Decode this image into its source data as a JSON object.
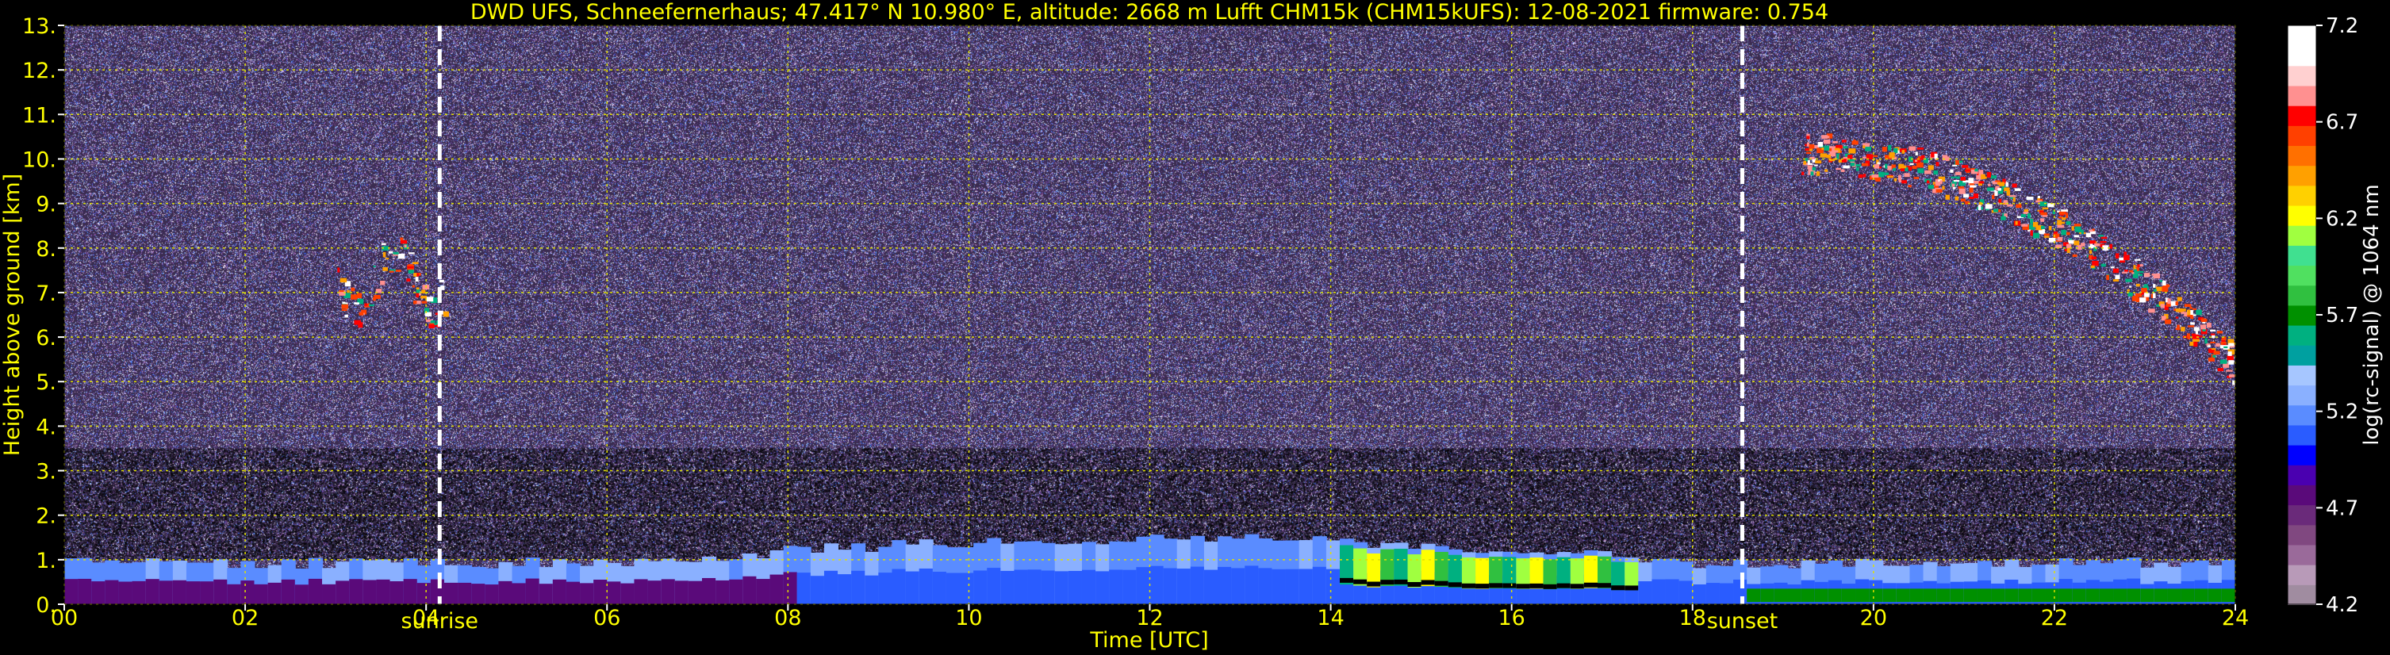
{
  "chart_data": {
    "type": "heatmap",
    "title": "DWD UFS, Schneefernerhaus; 47.417° N 10.980° E, altitude: 2668 m    Lufft CHM15k (CHM15kUFS): 12-08-2021    firmware: 0.754",
    "xlabel": "Time [UTC]",
    "ylabel": "Height above ground [km]",
    "xlim": [
      0,
      24
    ],
    "ylim": [
      0,
      13
    ],
    "x_ticks": [
      "00",
      "02",
      "04",
      "06",
      "08",
      "10",
      "12",
      "14",
      "16",
      "18",
      "20",
      "22",
      "24"
    ],
    "y_ticks": [
      "0.",
      "1.",
      "2.",
      "3.",
      "4.",
      "5.",
      "6.",
      "7.",
      "8.",
      "9.",
      "10.",
      "11.",
      "12.",
      "13."
    ],
    "grid": true,
    "markers": [
      {
        "label": "sunrise",
        "x": 4.15
      },
      {
        "label": "sunset",
        "x": 18.55
      }
    ],
    "colorbar": {
      "label": "log(rc-signal) @ 1064 nm",
      "range": [
        4.2,
        7.2
      ],
      "ticks": [
        "4.2",
        "4.7",
        "5.2",
        "5.7",
        "6.2",
        "6.7",
        "7.2"
      ],
      "colors": [
        "#a08ca0",
        "#b89ab8",
        "#9a6a9a",
        "#804880",
        "#6a2a7a",
        "#5a0a7a",
        "#4a00b0",
        "#0000ff",
        "#2a5cff",
        "#5a8cff",
        "#8ab0ff",
        "#a6c6ff",
        "#00a0a0",
        "#00b080",
        "#009000",
        "#30c040",
        "#50e060",
        "#40e090",
        "#a0ff40",
        "#ffff00",
        "#ffd000",
        "#ffa000",
        "#ff7000",
        "#ff4000",
        "#ff0000",
        "#ff9090",
        "#ffd0d0",
        "#ffffff",
        "#ffffff"
      ]
    },
    "features": [
      {
        "kind": "boundary_layer",
        "from_hour": 0,
        "to_hour": 24,
        "top_km_range": [
          0.8,
          1.8
        ]
      },
      {
        "kind": "cirrus",
        "from_hour": 3.0,
        "to_hour": 4.2,
        "height_km_range": [
          6.7,
          8.8
        ]
      },
      {
        "kind": "cirrus",
        "from_hour": 19.2,
        "to_hour": 24.0,
        "height_km_range": [
          5.8,
          10.6
        ]
      }
    ]
  }
}
